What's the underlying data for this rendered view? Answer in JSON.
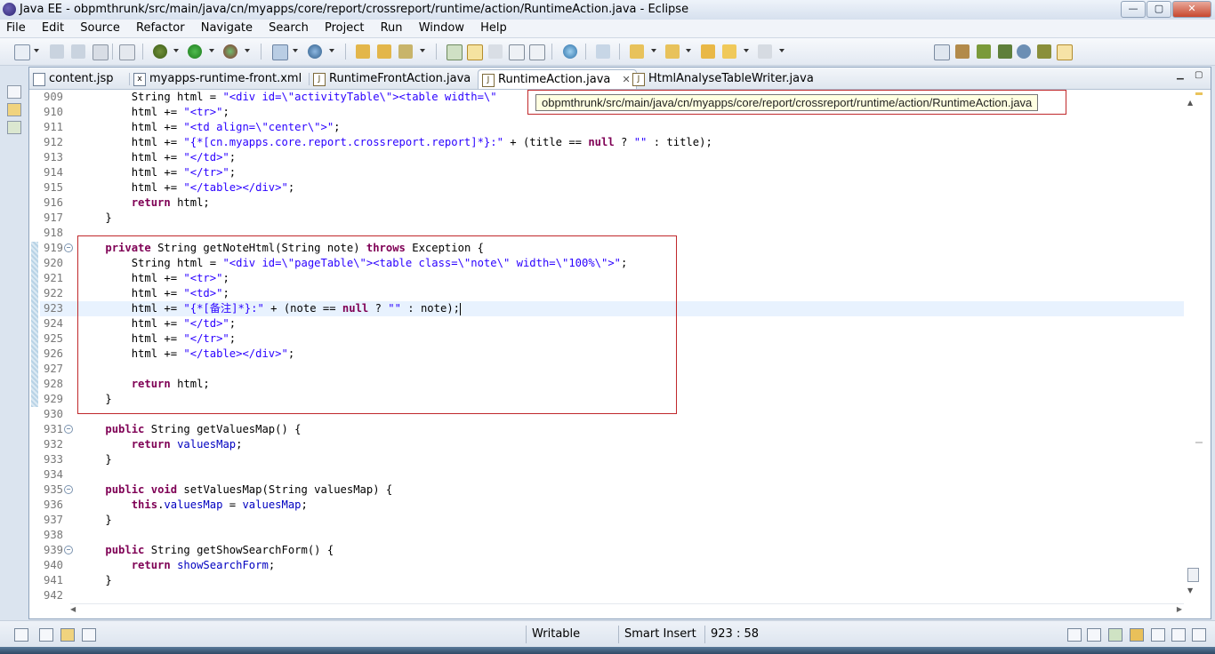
{
  "window": {
    "title": "Java EE - obpmthrunk/src/main/java/cn/myapps/core/report/crossreport/runtime/action/RuntimeAction.java - Eclipse",
    "controls": [
      "—",
      "▢",
      "✕"
    ]
  },
  "menu": [
    "File",
    "Edit",
    "Source",
    "Refactor",
    "Navigate",
    "Search",
    "Project",
    "Run",
    "Window",
    "Help"
  ],
  "tabs": [
    {
      "label": "content.jsp",
      "icon": "jsp-file-icon"
    },
    {
      "label": "myapps-runtime-front.xml",
      "icon": "xml-file-icon"
    },
    {
      "label": "RuntimeFrontAction.java",
      "icon": "java-file-icon"
    },
    {
      "label": "RuntimeAction.java",
      "icon": "java-file-icon",
      "active": true,
      "close": "✕"
    },
    {
      "label": "HtmlAnalyseTableWriter.java",
      "icon": "java-file-icon"
    }
  ],
  "tooltip": "obpmthrunk/src/main/java/cn/myapps/core/report/crossreport/runtime/action/RuntimeAction.java",
  "code_lines": [
    {
      "n": "909",
      "code": "        String html = \"<div id=\\\"activityTable\\\"><table width=\\\""
    },
    {
      "n": "910",
      "code": "        html += \"<tr>\";"
    },
    {
      "n": "911",
      "code": "        html += \"<td align=\\\"center\\\">\";"
    },
    {
      "n": "912",
      "code": "        html += \"{*[cn.myapps.core.report.crossreport.report]*}:\" + (title == null ? \"\" : title);"
    },
    {
      "n": "913",
      "code": "        html += \"</td>\";"
    },
    {
      "n": "914",
      "code": "        html += \"</tr>\";"
    },
    {
      "n": "915",
      "code": "        html += \"</table></div>\";"
    },
    {
      "n": "916",
      "code": "        return html;"
    },
    {
      "n": "917",
      "code": "    }"
    },
    {
      "n": "918",
      "code": ""
    },
    {
      "n": "919",
      "code": "    private String getNoteHtml(String note) throws Exception {",
      "fold": true
    },
    {
      "n": "920",
      "code": "        String html = \"<div id=\\\"pageTable\\\"><table class=\\\"note\\\" width=\\\"100%\\\">\";"
    },
    {
      "n": "921",
      "code": "        html += \"<tr>\";"
    },
    {
      "n": "922",
      "code": "        html += \"<td>\";"
    },
    {
      "n": "923",
      "code": "        html += \"{*[备注]*}:\" + (note == null ? \"\" : note);",
      "current": true
    },
    {
      "n": "924",
      "code": "        html += \"</td>\";"
    },
    {
      "n": "925",
      "code": "        html += \"</tr>\";"
    },
    {
      "n": "926",
      "code": "        html += \"</table></div>\";"
    },
    {
      "n": "927",
      "code": ""
    },
    {
      "n": "928",
      "code": "        return html;"
    },
    {
      "n": "929",
      "code": "    }"
    },
    {
      "n": "930",
      "code": ""
    },
    {
      "n": "931",
      "code": "    public String getValuesMap() {",
      "fold": true
    },
    {
      "n": "932",
      "code": "        return valuesMap;"
    },
    {
      "n": "933",
      "code": "    }"
    },
    {
      "n": "934",
      "code": ""
    },
    {
      "n": "935",
      "code": "    public void setValuesMap(String valuesMap) {",
      "fold": true
    },
    {
      "n": "936",
      "code": "        this.valuesMap = valuesMap;"
    },
    {
      "n": "937",
      "code": "    }"
    },
    {
      "n": "938",
      "code": ""
    },
    {
      "n": "939",
      "code": "    public String getShowSearchForm() {",
      "fold": true
    },
    {
      "n": "940",
      "code": "        return showSearchForm;"
    },
    {
      "n": "941",
      "code": "    }"
    },
    {
      "n": "942",
      "code": ""
    }
  ],
  "status": {
    "writable": "Writable",
    "insert_mode": "Smart Insert",
    "position": "923 : 58"
  },
  "colors": {
    "keyword": "#7f0055",
    "string": "#2a00ff",
    "field": "#0000c0",
    "highlight_box": "#c0282b",
    "current_line": "#e8f2fe"
  }
}
